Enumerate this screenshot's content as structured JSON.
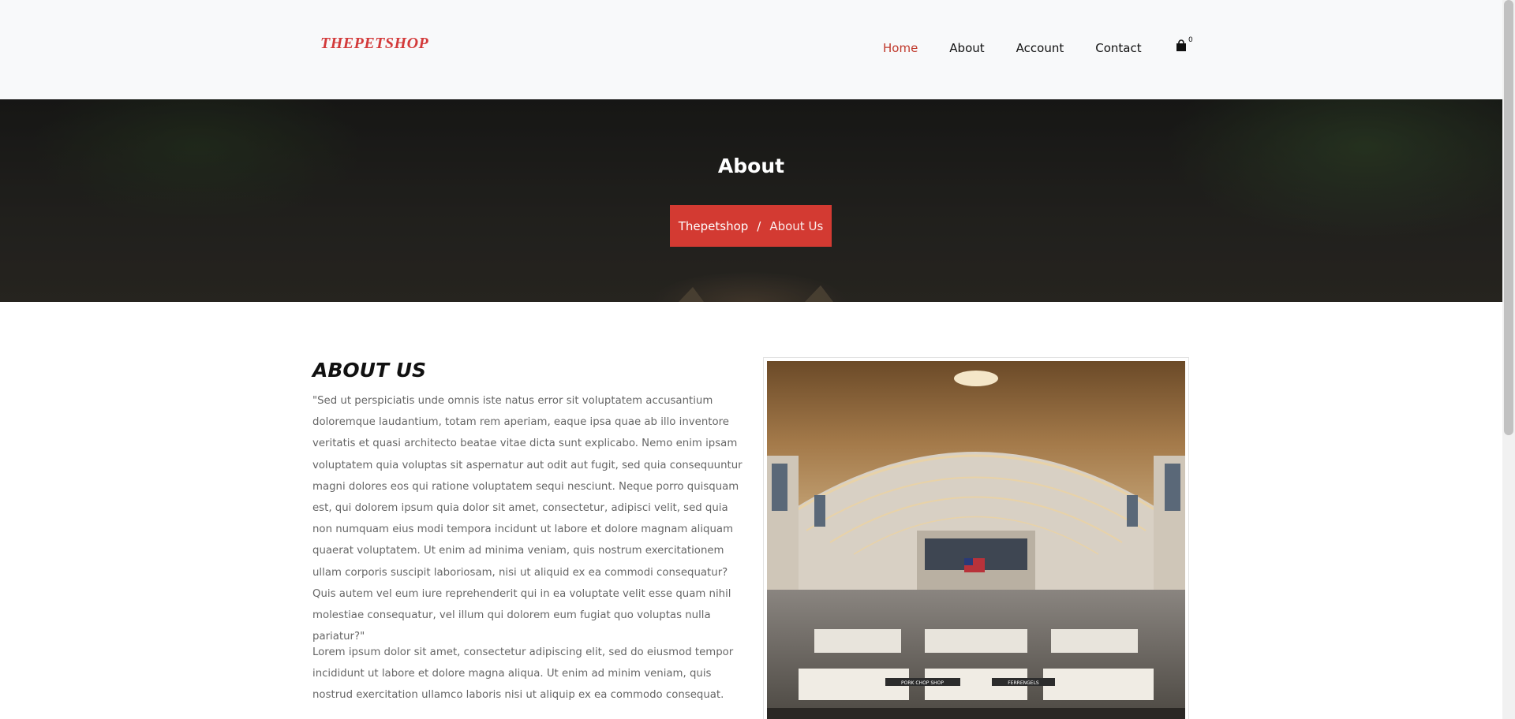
{
  "brand": {
    "logo_text": "THEPETSHOP",
    "accent": "#d33a32"
  },
  "nav": {
    "items": [
      {
        "label": "Home",
        "active": true
      },
      {
        "label": "About",
        "active": false
      },
      {
        "label": "Account",
        "active": false
      },
      {
        "label": "Contact",
        "active": false
      }
    ],
    "cart": {
      "icon": "shopping-bag-icon",
      "count": "0"
    }
  },
  "hero": {
    "title": "About",
    "breadcrumb": {
      "home": "Thepetshop",
      "separator": "/",
      "current": "About Us"
    }
  },
  "about": {
    "heading": "ABOUT US",
    "paragraph_1": "\"Sed ut perspiciatis unde omnis iste natus error sit voluptatem accusantium doloremque laudantium, totam rem aperiam, eaque ipsa quae ab illo inventore veritatis et quasi architecto beatae vitae dicta sunt explicabo. Nemo enim ipsam voluptatem quia voluptas sit aspernatur aut odit aut fugit, sed quia consequuntur magni dolores eos qui ratione voluptatem sequi nesciunt. Neque porro quisquam est, qui dolorem ipsum quia dolor sit amet, consectetur, adipisci velit, sed quia non numquam eius modi tempora incidunt ut labore et dolore magnam aliquam quaerat voluptatem. Ut enim ad minima veniam, quis nostrum exercitationem ullam corporis suscipit laboriosam, nisi ut aliquid ex ea commodi consequatur? Quis autem vel eum iure reprehenderit qui in ea voluptate velit esse quam nihil molestiae consequatur, vel illum qui dolorem eum fugiat quo voluptas nulla pariatur?\"",
    "paragraph_2": "Lorem ipsum dolor sit amet, consectetur adipiscing elit, sed do eiusmod tempor incididunt ut labore et dolore magna aliqua. Ut enim ad minim veniam, quis nostrud exercitation ullamco laboris nisi ut aliquip ex ea commodo consequat.",
    "image": {
      "signs": [
        "PORK CHOP SHOP",
        "FERRENGELS"
      ]
    }
  }
}
